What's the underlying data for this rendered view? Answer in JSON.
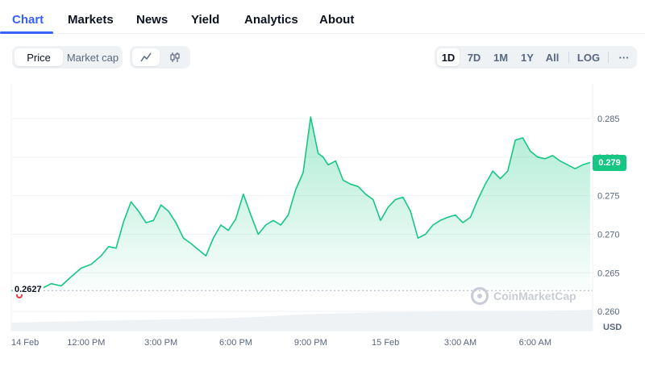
{
  "tabs": [
    {
      "label": "Chart",
      "active": true
    },
    {
      "label": "Markets"
    },
    {
      "label": "News"
    },
    {
      "label": "Yield"
    },
    {
      "label": "Analytics"
    },
    {
      "label": "About"
    }
  ],
  "metric_toggle": {
    "options": [
      "Price",
      "Market cap"
    ],
    "selected": "Price"
  },
  "chart_style": {
    "options": [
      "line-chart-icon",
      "candlestick-icon"
    ],
    "selected": "line-chart-icon"
  },
  "ranges": {
    "options": [
      "1D",
      "7D",
      "1M",
      "1Y",
      "All",
      "LOG"
    ],
    "selected": "1D",
    "more_label": "···"
  },
  "colors": {
    "up": "#16c784",
    "down": "#ea3943",
    "accent": "#3861fb"
  },
  "watermark": "CoinMarketCap",
  "currency_label": "USD",
  "current_price_label": "0.279",
  "open_price_label": "0.2627",
  "chart_data": {
    "type": "line",
    "title": "",
    "xlabel": "",
    "ylabel": "",
    "x_tick_labels": [
      "14 Feb",
      "12:00 PM",
      "3:00 PM",
      "6:00 PM",
      "9:00 PM",
      "15 Feb",
      "3:00 AM",
      "6:00 AM"
    ],
    "x_tick_hours": [
      0,
      3,
      6,
      9,
      12,
      15,
      18,
      21
    ],
    "y_ticks": [
      0.285,
      0.28,
      0.275,
      0.27,
      0.265,
      0.26
    ],
    "ylim": [
      0.2575,
      0.2895
    ],
    "xlim_hours": [
      0,
      23.3
    ],
    "reference_line": 0.2627,
    "price_series": {
      "x_hours": [
        0,
        1.0,
        1.3,
        1.6,
        2.0,
        2.4,
        2.8,
        3.2,
        3.6,
        3.9,
        4.2,
        4.5,
        4.8,
        5.1,
        5.4,
        5.7,
        6.0,
        6.3,
        6.6,
        6.9,
        7.2,
        7.5,
        7.8,
        8.1,
        8.4,
        8.7,
        9.0,
        9.3,
        9.6,
        9.9,
        10.2,
        10.5,
        10.8,
        11.1,
        11.4,
        11.7,
        12.0,
        12.3,
        12.5,
        12.7,
        13.0,
        13.3,
        13.6,
        13.9,
        14.2,
        14.5,
        14.8,
        15.1,
        15.4,
        15.7,
        16.0,
        16.3,
        16.6,
        16.9,
        17.2,
        17.5,
        17.8,
        18.1,
        18.4,
        18.7,
        19.0,
        19.3,
        19.6,
        19.9,
        20.2,
        20.5,
        20.8,
        21.1,
        21.4,
        21.7,
        22.0,
        22.3,
        22.6,
        22.9,
        23.2
      ],
      "values": [
        0.2627,
        0.2627,
        0.2631,
        0.2636,
        0.2633,
        0.2645,
        0.2656,
        0.2661,
        0.2672,
        0.2684,
        0.2682,
        0.2716,
        0.2742,
        0.273,
        0.2715,
        0.2718,
        0.2738,
        0.273,
        0.2715,
        0.2695,
        0.2688,
        0.268,
        0.2672,
        0.2695,
        0.2712,
        0.2705,
        0.272,
        0.2752,
        0.2725,
        0.27,
        0.2712,
        0.2718,
        0.2712,
        0.2725,
        0.2758,
        0.278,
        0.2852,
        0.2805,
        0.28,
        0.279,
        0.2795,
        0.277,
        0.2765,
        0.2762,
        0.2752,
        0.2745,
        0.2718,
        0.2735,
        0.2745,
        0.2748,
        0.273,
        0.2695,
        0.27,
        0.2712,
        0.2718,
        0.2722,
        0.2725,
        0.2715,
        0.2722,
        0.2745,
        0.2765,
        0.2782,
        0.2772,
        0.2782,
        0.2822,
        0.2825,
        0.2808,
        0.28,
        0.2798,
        0.2802,
        0.2795,
        0.279,
        0.2785,
        0.279,
        0.2793
      ]
    },
    "volume_series": {
      "x_hours": [
        0,
        3,
        6,
        9,
        12,
        15,
        18,
        21,
        23.3
      ],
      "relative_values": [
        0.35,
        0.42,
        0.48,
        0.55,
        0.72,
        0.8,
        0.82,
        0.85,
        0.9
      ]
    }
  }
}
